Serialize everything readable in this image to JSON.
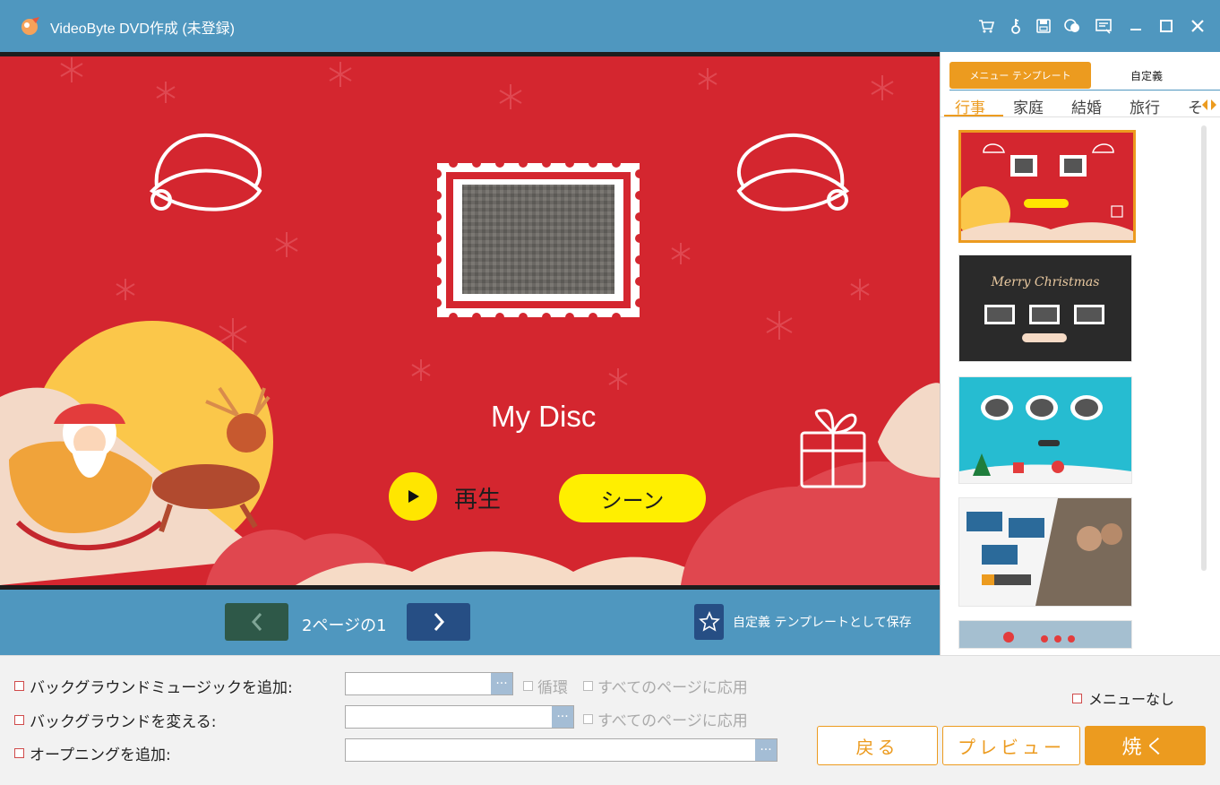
{
  "window": {
    "title": "VideoByte DVD作成 (未登録)",
    "icons": [
      "cart-icon",
      "key-icon",
      "save-icon",
      "chat-icon",
      "feedback-icon",
      "minimize-icon",
      "maximize-icon",
      "close-icon"
    ]
  },
  "preview": {
    "disc_title": "My Disc",
    "play_label": "再生",
    "scene_label": "シーン"
  },
  "nav": {
    "page_info": "2ページの1",
    "save_template_label": "自定義 テンプレートとして保存"
  },
  "sidebar": {
    "tab_menu": "メニュー テンプレート",
    "tab_custom": "自定義",
    "categories": [
      "行事",
      "家庭",
      "結婚",
      "旅行",
      "そ"
    ],
    "active_category": "行事",
    "thumb2_text": "Merry Christmas"
  },
  "options": {
    "bg_music_label": "バックグラウンドミュージックを追加:",
    "loop_label": "循環",
    "apply_all_label": "すべてのページに応用",
    "bg_change_label": "バックグラウンドを変える:",
    "apply_all_label_2": "すべてのページに応用",
    "opening_label": "オープニングを追加:",
    "browse": "···",
    "no_menu_label": "メニューなし"
  },
  "buttons": {
    "back": "戻る",
    "preview": "プレビュー",
    "burn": "焼く"
  },
  "colors": {
    "titlebar": "#4f97bf",
    "accent": "#ec9b1f",
    "stage_red": "#d4262f",
    "yellow": "#ffe600"
  }
}
